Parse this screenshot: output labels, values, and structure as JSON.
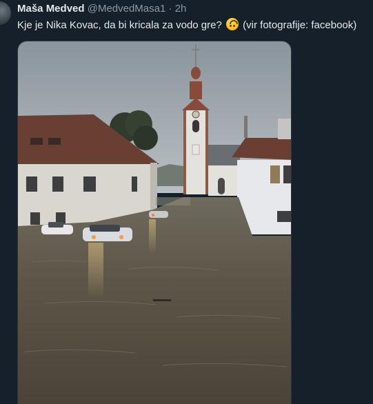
{
  "tweet": {
    "display_name": "Maša Medved",
    "handle": "@MedvedMasa1",
    "separator": "·",
    "time": "2h",
    "text_before_emoji": "Kje je Nika Kovac, da bi kricala za vodo gre?",
    "emoji": "upside-down-face-emoji",
    "text_after_emoji": "(vir fotografije: facebook)"
  },
  "colors": {
    "background": "#15202b",
    "primary_text": "#e7e9ea",
    "secondary_text": "#8b98a5"
  },
  "media": {
    "description_icon": "flooded-village-photo"
  }
}
